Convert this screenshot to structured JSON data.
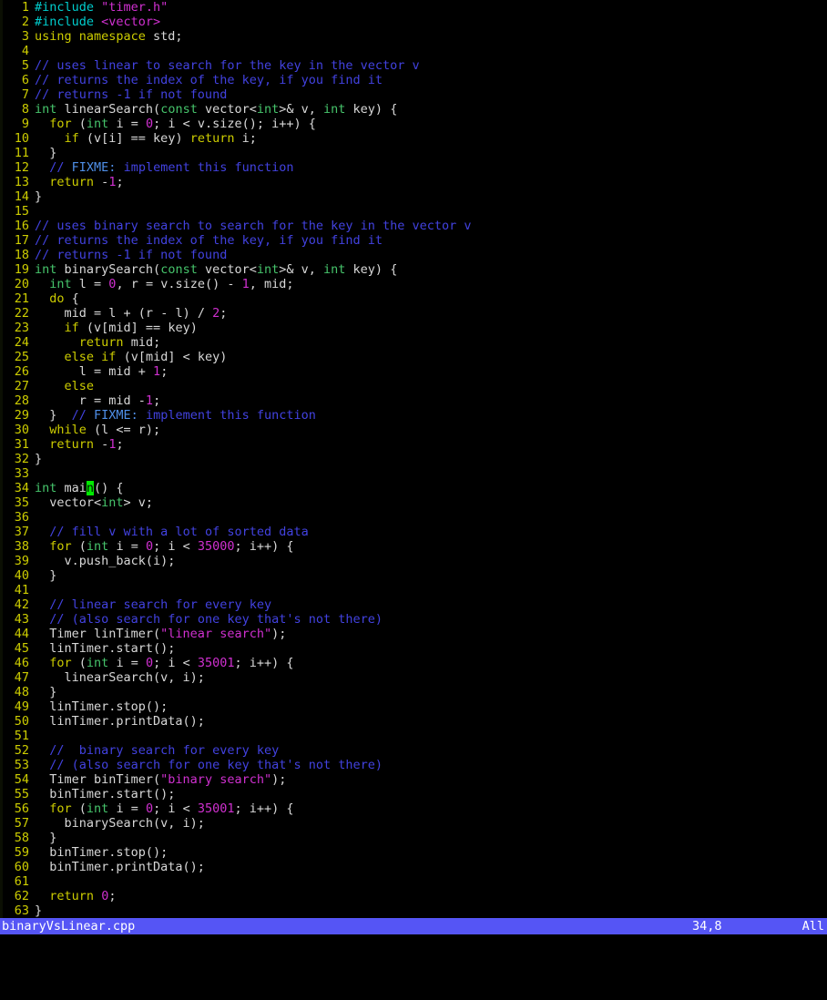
{
  "app": {
    "kind": "vim-terminal-editor",
    "filename": "binaryVsLinear.cpp",
    "language": "cpp"
  },
  "statusline": {
    "file_label": "binaryVsLinear.cpp",
    "ruler_label": "34,8",
    "position_label": "All"
  },
  "cmdline": {
    "text": ""
  },
  "cursor": {
    "line": 34,
    "column": 8,
    "char": "n",
    "color": "#00e800"
  },
  "colors": {
    "background": "#000000",
    "foreground": "#d8d8d8",
    "line_number": "#cdcd00",
    "comment": "#4242e0",
    "todo": "#4f8fe8",
    "string": "#d030d0",
    "number": "#d030d0",
    "preproc": "#00cdcd",
    "type": "#46c46b",
    "statement": "#cdcd00",
    "statusline_bg": "#5555f5",
    "statusline_fg": "#ffffff",
    "cursor_bg": "#00e800"
  },
  "lines": [
    {
      "n": 1,
      "tokens": [
        {
          "t": "#include ",
          "c": "pre"
        },
        {
          "t": "\"timer.h\"",
          "c": "str"
        }
      ]
    },
    {
      "n": 2,
      "tokens": [
        {
          "t": "#include ",
          "c": "pre"
        },
        {
          "t": "<vector>",
          "c": "str"
        }
      ]
    },
    {
      "n": 3,
      "tokens": [
        {
          "t": "using namespace",
          "c": "kw"
        },
        {
          "t": " std;",
          "c": "id"
        }
      ]
    },
    {
      "n": 4,
      "tokens": []
    },
    {
      "n": 5,
      "tokens": [
        {
          "t": "// uses linear to search for the key in the vector v",
          "c": "cmt"
        }
      ]
    },
    {
      "n": 6,
      "tokens": [
        {
          "t": "// returns the index of the key, if you find it",
          "c": "cmt"
        }
      ]
    },
    {
      "n": 7,
      "tokens": [
        {
          "t": "// returns -1 if not found",
          "c": "cmt"
        }
      ]
    },
    {
      "n": 8,
      "tokens": [
        {
          "t": "int",
          "c": "type"
        },
        {
          "t": " linearSearch(",
          "c": "id"
        },
        {
          "t": "const",
          "c": "type"
        },
        {
          "t": " vector<",
          "c": "id"
        },
        {
          "t": "int",
          "c": "type"
        },
        {
          "t": ">& v, ",
          "c": "id"
        },
        {
          "t": "int",
          "c": "type"
        },
        {
          "t": " key) {",
          "c": "id"
        }
      ]
    },
    {
      "n": 9,
      "tokens": [
        {
          "t": "  ",
          "c": "id"
        },
        {
          "t": "for",
          "c": "kw"
        },
        {
          "t": " (",
          "c": "id"
        },
        {
          "t": "int",
          "c": "type"
        },
        {
          "t": " i = ",
          "c": "id"
        },
        {
          "t": "0",
          "c": "num"
        },
        {
          "t": "; i < v.size(); i++) {",
          "c": "id"
        }
      ]
    },
    {
      "n": 10,
      "tokens": [
        {
          "t": "    ",
          "c": "id"
        },
        {
          "t": "if",
          "c": "kw"
        },
        {
          "t": " (v[i] == key) ",
          "c": "id"
        },
        {
          "t": "return",
          "c": "kw"
        },
        {
          "t": " i;",
          "c": "id"
        }
      ]
    },
    {
      "n": 11,
      "tokens": [
        {
          "t": "  }",
          "c": "id"
        }
      ]
    },
    {
      "n": 12,
      "tokens": [
        {
          "t": "  ",
          "c": "id"
        },
        {
          "t": "// ",
          "c": "cmt"
        },
        {
          "t": "FIXME:",
          "c": "todo"
        },
        {
          "t": " implement this function",
          "c": "cmt"
        }
      ]
    },
    {
      "n": 13,
      "tokens": [
        {
          "t": "  ",
          "c": "id"
        },
        {
          "t": "return",
          "c": "kw"
        },
        {
          "t": " -",
          "c": "id"
        },
        {
          "t": "1",
          "c": "num"
        },
        {
          "t": ";",
          "c": "id"
        }
      ]
    },
    {
      "n": 14,
      "tokens": [
        {
          "t": "}",
          "c": "id"
        }
      ]
    },
    {
      "n": 15,
      "tokens": []
    },
    {
      "n": 16,
      "tokens": [
        {
          "t": "// uses binary search to search for the key in the vector v",
          "c": "cmt"
        }
      ]
    },
    {
      "n": 17,
      "tokens": [
        {
          "t": "// returns the index of the key, if you find it",
          "c": "cmt"
        }
      ]
    },
    {
      "n": 18,
      "tokens": [
        {
          "t": "// returns -1 if not found",
          "c": "cmt"
        }
      ]
    },
    {
      "n": 19,
      "tokens": [
        {
          "t": "int",
          "c": "type"
        },
        {
          "t": " binarySearch(",
          "c": "id"
        },
        {
          "t": "const",
          "c": "type"
        },
        {
          "t": " vector<",
          "c": "id"
        },
        {
          "t": "int",
          "c": "type"
        },
        {
          "t": ">& v, ",
          "c": "id"
        },
        {
          "t": "int",
          "c": "type"
        },
        {
          "t": " key) {",
          "c": "id"
        }
      ]
    },
    {
      "n": 20,
      "tokens": [
        {
          "t": "  ",
          "c": "id"
        },
        {
          "t": "int",
          "c": "type"
        },
        {
          "t": " l = ",
          "c": "id"
        },
        {
          "t": "0",
          "c": "num"
        },
        {
          "t": ", r = v.size() - ",
          "c": "id"
        },
        {
          "t": "1",
          "c": "num"
        },
        {
          "t": ", mid;",
          "c": "id"
        }
      ]
    },
    {
      "n": 21,
      "tokens": [
        {
          "t": "  ",
          "c": "id"
        },
        {
          "t": "do",
          "c": "kw"
        },
        {
          "t": " {",
          "c": "id"
        }
      ]
    },
    {
      "n": 22,
      "tokens": [
        {
          "t": "    mid = ",
          "c": "id"
        },
        {
          "t": "l",
          "c": "id"
        },
        {
          "t": " + (r - ",
          "c": "id"
        },
        {
          "t": "l",
          "c": "id"
        },
        {
          "t": ") / ",
          "c": "id"
        },
        {
          "t": "2",
          "c": "num"
        },
        {
          "t": ";",
          "c": "id"
        }
      ]
    },
    {
      "n": 23,
      "tokens": [
        {
          "t": "    ",
          "c": "id"
        },
        {
          "t": "if",
          "c": "kw"
        },
        {
          "t": " (v[mid] == key)",
          "c": "id"
        }
      ]
    },
    {
      "n": 24,
      "tokens": [
        {
          "t": "      ",
          "c": "id"
        },
        {
          "t": "return",
          "c": "kw"
        },
        {
          "t": " mid;",
          "c": "id"
        }
      ]
    },
    {
      "n": 25,
      "tokens": [
        {
          "t": "    ",
          "c": "id"
        },
        {
          "t": "else",
          "c": "kw"
        },
        {
          "t": " ",
          "c": "id"
        },
        {
          "t": "if",
          "c": "kw"
        },
        {
          "t": " (v[mid] < key)",
          "c": "id"
        }
      ]
    },
    {
      "n": 26,
      "tokens": [
        {
          "t": "      l = mid + ",
          "c": "id"
        },
        {
          "t": "1",
          "c": "num"
        },
        {
          "t": ";",
          "c": "id"
        }
      ]
    },
    {
      "n": 27,
      "tokens": [
        {
          "t": "    ",
          "c": "id"
        },
        {
          "t": "else",
          "c": "kw"
        }
      ]
    },
    {
      "n": 28,
      "tokens": [
        {
          "t": "      r = mid -",
          "c": "id"
        },
        {
          "t": "1",
          "c": "num"
        },
        {
          "t": ";",
          "c": "id"
        }
      ]
    },
    {
      "n": 29,
      "tokens": [
        {
          "t": "  }  ",
          "c": "id"
        },
        {
          "t": "// ",
          "c": "cmt"
        },
        {
          "t": "FIXME:",
          "c": "todo"
        },
        {
          "t": " implement this function",
          "c": "cmt"
        }
      ]
    },
    {
      "n": 30,
      "tokens": [
        {
          "t": "  ",
          "c": "id"
        },
        {
          "t": "while",
          "c": "kw"
        },
        {
          "t": " (l <= r);",
          "c": "id"
        }
      ]
    },
    {
      "n": 31,
      "tokens": [
        {
          "t": "  ",
          "c": "id"
        },
        {
          "t": "return",
          "c": "kw"
        },
        {
          "t": " -",
          "c": "id"
        },
        {
          "t": "1",
          "c": "num"
        },
        {
          "t": ";",
          "c": "id"
        }
      ]
    },
    {
      "n": 32,
      "tokens": [
        {
          "t": "}",
          "c": "id"
        }
      ]
    },
    {
      "n": 33,
      "tokens": []
    },
    {
      "n": 34,
      "tokens": [
        {
          "t": "int",
          "c": "type"
        },
        {
          "t": " mai",
          "c": "id"
        },
        {
          "t": "n",
          "c": "id cursor"
        },
        {
          "t": "() {",
          "c": "id"
        }
      ]
    },
    {
      "n": 35,
      "tokens": [
        {
          "t": "  vector<",
          "c": "id"
        },
        {
          "t": "int",
          "c": "type"
        },
        {
          "t": "> v;",
          "c": "id"
        }
      ]
    },
    {
      "n": 36,
      "tokens": []
    },
    {
      "n": 37,
      "tokens": [
        {
          "t": "  ",
          "c": "id"
        },
        {
          "t": "// fill v with a lot of sorted data",
          "c": "cmt"
        }
      ]
    },
    {
      "n": 38,
      "tokens": [
        {
          "t": "  ",
          "c": "id"
        },
        {
          "t": "for",
          "c": "kw"
        },
        {
          "t": " (",
          "c": "id"
        },
        {
          "t": "int",
          "c": "type"
        },
        {
          "t": " i = ",
          "c": "id"
        },
        {
          "t": "0",
          "c": "num"
        },
        {
          "t": "; i < ",
          "c": "id"
        },
        {
          "t": "35000",
          "c": "num"
        },
        {
          "t": "; i++) {",
          "c": "id"
        }
      ]
    },
    {
      "n": 39,
      "tokens": [
        {
          "t": "    v.push_back(i);",
          "c": "id"
        }
      ]
    },
    {
      "n": 40,
      "tokens": [
        {
          "t": "  }",
          "c": "id"
        }
      ]
    },
    {
      "n": 41,
      "tokens": []
    },
    {
      "n": 42,
      "tokens": [
        {
          "t": "  ",
          "c": "id"
        },
        {
          "t": "// linear search for every key",
          "c": "cmt"
        }
      ]
    },
    {
      "n": 43,
      "tokens": [
        {
          "t": "  ",
          "c": "id"
        },
        {
          "t": "// (also search for one key that's not there)",
          "c": "cmt"
        }
      ]
    },
    {
      "n": 44,
      "tokens": [
        {
          "t": "  Timer linTimer(",
          "c": "id"
        },
        {
          "t": "\"linear search\"",
          "c": "str"
        },
        {
          "t": ");",
          "c": "id"
        }
      ]
    },
    {
      "n": 45,
      "tokens": [
        {
          "t": "  linTimer.start();",
          "c": "id"
        }
      ]
    },
    {
      "n": 46,
      "tokens": [
        {
          "t": "  ",
          "c": "id"
        },
        {
          "t": "for",
          "c": "kw"
        },
        {
          "t": " (",
          "c": "id"
        },
        {
          "t": "int",
          "c": "type"
        },
        {
          "t": " i = ",
          "c": "id"
        },
        {
          "t": "0",
          "c": "num"
        },
        {
          "t": "; i < ",
          "c": "id"
        },
        {
          "t": "35001",
          "c": "num"
        },
        {
          "t": "; i++) {",
          "c": "id"
        }
      ]
    },
    {
      "n": 47,
      "tokens": [
        {
          "t": "    linearSearch(v, i);",
          "c": "id"
        }
      ]
    },
    {
      "n": 48,
      "tokens": [
        {
          "t": "  }",
          "c": "id"
        }
      ]
    },
    {
      "n": 49,
      "tokens": [
        {
          "t": "  linTimer.stop();",
          "c": "id"
        }
      ]
    },
    {
      "n": 50,
      "tokens": [
        {
          "t": "  linTimer.printData();",
          "c": "id"
        }
      ]
    },
    {
      "n": 51,
      "tokens": []
    },
    {
      "n": 52,
      "tokens": [
        {
          "t": "  ",
          "c": "id"
        },
        {
          "t": "//  binary search for every key",
          "c": "cmt"
        }
      ]
    },
    {
      "n": 53,
      "tokens": [
        {
          "t": "  ",
          "c": "id"
        },
        {
          "t": "// (also search for one key that's not there)",
          "c": "cmt"
        }
      ]
    },
    {
      "n": 54,
      "tokens": [
        {
          "t": "  Timer binTimer(",
          "c": "id"
        },
        {
          "t": "\"binary search\"",
          "c": "str"
        },
        {
          "t": ");",
          "c": "id"
        }
      ]
    },
    {
      "n": 55,
      "tokens": [
        {
          "t": "  binTimer.start();",
          "c": "id"
        }
      ]
    },
    {
      "n": 56,
      "tokens": [
        {
          "t": "  ",
          "c": "id"
        },
        {
          "t": "for",
          "c": "kw"
        },
        {
          "t": " (",
          "c": "id"
        },
        {
          "t": "int",
          "c": "type"
        },
        {
          "t": " i = ",
          "c": "id"
        },
        {
          "t": "0",
          "c": "num"
        },
        {
          "t": "; i < ",
          "c": "id"
        },
        {
          "t": "35001",
          "c": "num"
        },
        {
          "t": "; i++) {",
          "c": "id"
        }
      ]
    },
    {
      "n": 57,
      "tokens": [
        {
          "t": "    binarySearch(v, i);",
          "c": "id"
        }
      ]
    },
    {
      "n": 58,
      "tokens": [
        {
          "t": "  }",
          "c": "id"
        }
      ]
    },
    {
      "n": 59,
      "tokens": [
        {
          "t": "  binTimer.stop();",
          "c": "id"
        }
      ]
    },
    {
      "n": 60,
      "tokens": [
        {
          "t": "  binTimer.printData();",
          "c": "id"
        }
      ]
    },
    {
      "n": 61,
      "tokens": []
    },
    {
      "n": 62,
      "tokens": [
        {
          "t": "  ",
          "c": "id"
        },
        {
          "t": "return",
          "c": "kw"
        },
        {
          "t": " ",
          "c": "id"
        },
        {
          "t": "0",
          "c": "num"
        },
        {
          "t": ";",
          "c": "id"
        }
      ]
    },
    {
      "n": 63,
      "tokens": [
        {
          "t": "}",
          "c": "id"
        }
      ]
    }
  ]
}
